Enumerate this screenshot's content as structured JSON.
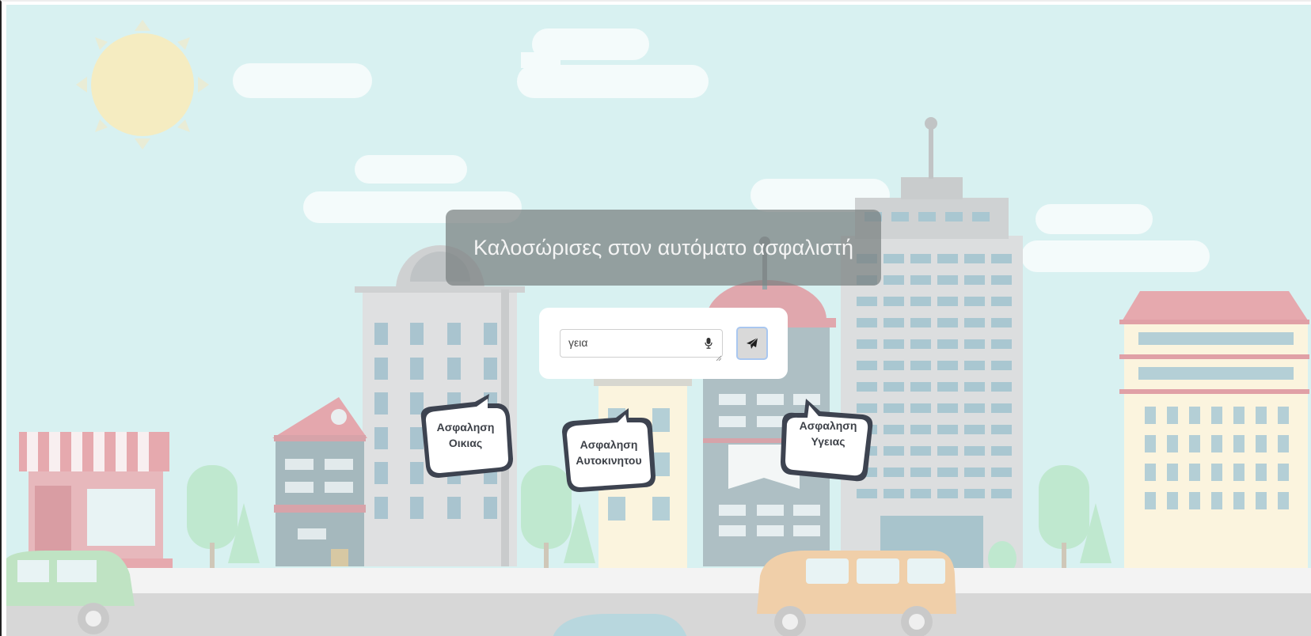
{
  "welcome": {
    "title": "Καλοσώρισες στον αυτόματο ασφαλιστή"
  },
  "chat": {
    "input_value": "γεια"
  },
  "options": [
    {
      "line1": "Ασφαληση",
      "line2": "Οικιας"
    },
    {
      "line1": "Ασφαληση",
      "line2": "Αυτοκινητου"
    },
    {
      "line1": "Ασφαληση",
      "line2": "Υγειας"
    }
  ],
  "colors": {
    "sky": "#d8f1f1",
    "road": "#d7d7d7",
    "send_button": "#d9d9d9",
    "send_border": "#a9c7f0"
  },
  "icons": {
    "mic": "microphone-icon",
    "send": "paper-plane-icon"
  }
}
